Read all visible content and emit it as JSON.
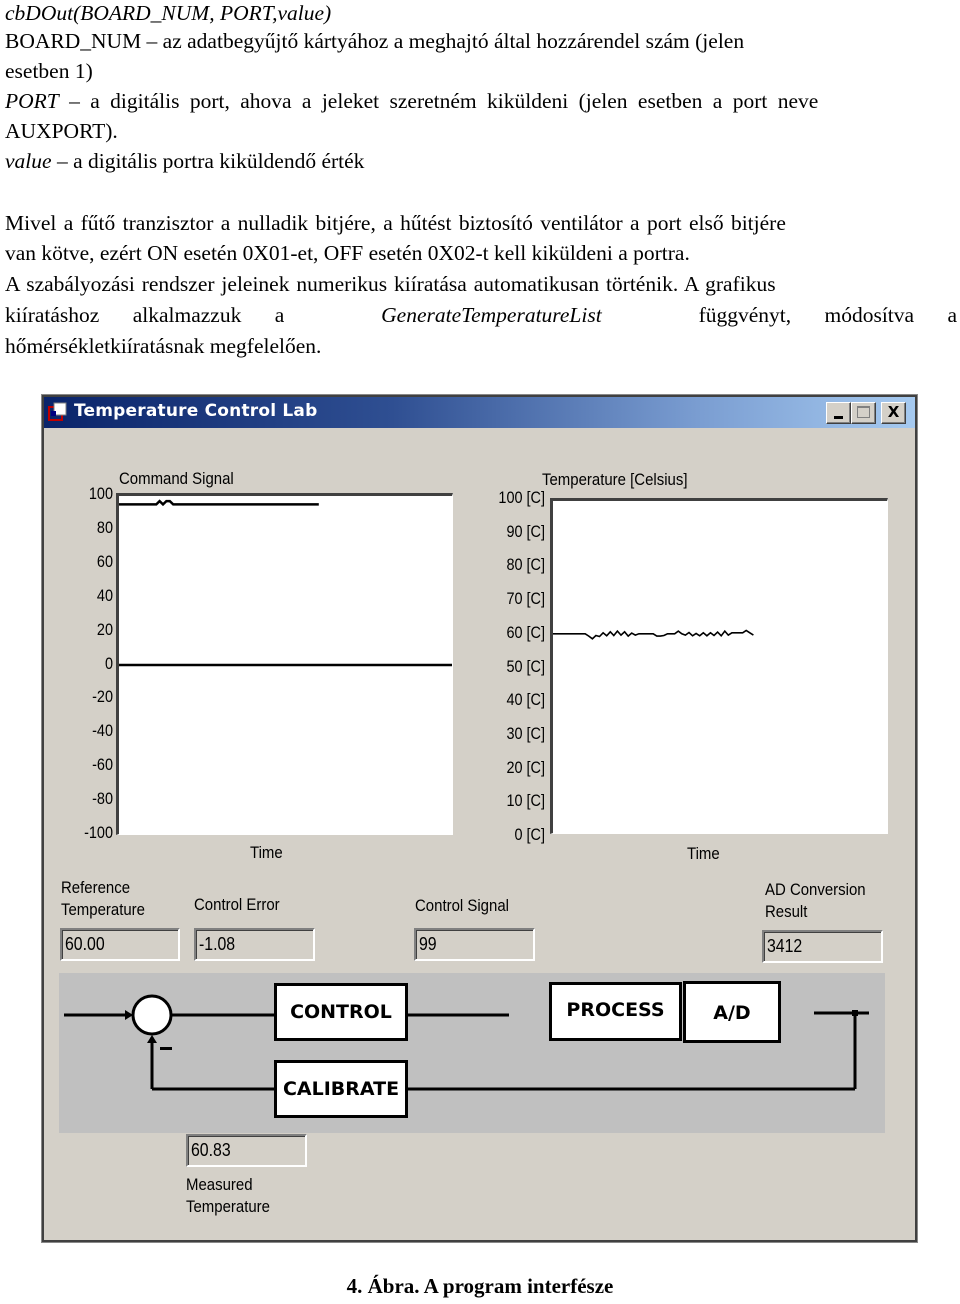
{
  "document": {
    "lines": [
      {
        "italic_prefix": "cbDOut(BOARD_NUM, PORT,value)",
        "text": ""
      },
      {
        "italic_prefix": "",
        "text": "BOARD_NUM – az adatbegyűjtő kártyához a meghajtó által hozzárendel szám (jelen"
      },
      {
        "italic_prefix": "",
        "text": "esetben 1)"
      },
      {
        "italic_prefix": "PORT",
        "text": " – a digitális port, ahova a jeleket szeretném kiküldeni (jelen esetben a port neve"
      },
      {
        "italic_prefix": "",
        "text": "AUXPORT)."
      },
      {
        "italic_prefix": "value",
        "text": " – a digitális portra kiküldendő érték"
      }
    ],
    "paragraph": [
      "Mivel a fűtő tranzisztor a nulladik bitjére, a hűtést biztosító ventilátor a port első bitjére",
      "van kötve, ezért ON esetén 0X01-et, OFF esetén 0X02-t kell kiküldeni a portra.",
      "A szabályozási rendszer jeleinek numerikus kiíratása automatikusan történik. A grafikus",
      "kiíratáshoz alkalmazzuk a",
      "GenerateTemperatureList",
      "függvényt, módosítva a",
      "hőmérsékletkiíratásnak megfelelően."
    ],
    "caption": "4. Ábra. A program interfésze"
  },
  "window": {
    "title": "Temperature Control Lab",
    "icon": "app-window-icon",
    "buttons": {
      "minimize": "minimize",
      "maximize": "maximize",
      "close": "X"
    }
  },
  "charts": {
    "command": {
      "title": "Command Signal",
      "xlabel": "Time",
      "yticks": [
        "100",
        "80",
        "60",
        "40",
        "20",
        "0",
        "-20",
        "-40",
        "-60",
        "-80",
        "-100"
      ]
    },
    "temperature": {
      "title": "Temperature [Celsius]",
      "xlabel": "Time",
      "yticks": [
        "100 [C]",
        "90 [C]",
        "80 [C]",
        "70 [C]",
        "60 [C]",
        "50 [C]",
        "40 [C]",
        "30 [C]",
        "20 [C]",
        "10 [C]",
        "0 [C]"
      ]
    }
  },
  "chart_data": [
    {
      "type": "line",
      "title": "Command Signal",
      "xlabel": "Time",
      "ylabel": "",
      "ylim": [
        -100,
        100
      ],
      "yticks": [
        100,
        80,
        60,
        40,
        20,
        0,
        -20,
        -40,
        -60,
        -80,
        -100
      ],
      "series": [
        {
          "name": "command",
          "x_fraction_end": 0.6,
          "values": [
            95,
            95,
            95,
            95,
            95,
            95,
            95,
            95,
            95,
            95,
            95,
            95,
            97,
            95,
            97,
            97,
            95,
            95,
            95,
            95,
            95,
            95,
            95,
            95,
            95,
            95,
            95,
            95,
            95,
            95,
            95,
            95,
            95,
            95,
            95,
            95,
            95,
            95,
            95,
            95,
            95,
            95,
            95,
            95,
            95,
            95,
            95,
            95,
            95,
            95,
            95,
            95,
            95,
            95,
            95,
            95,
            95,
            95,
            95,
            95
          ]
        },
        {
          "name": "zero-line",
          "x_fraction_end": 1.0,
          "values": [
            0,
            0
          ]
        }
      ]
    },
    {
      "type": "line",
      "title": "Temperature [Celsius]",
      "xlabel": "Time",
      "ylabel": "",
      "ylim": [
        0,
        100
      ],
      "yticks": [
        100,
        90,
        80,
        70,
        60,
        50,
        40,
        30,
        20,
        10,
        0
      ],
      "series": [
        {
          "name": "temperature",
          "x_fraction_end": 0.6,
          "values": [
            60,
            60,
            60,
            60,
            60,
            60,
            60,
            60,
            60,
            60,
            59.3,
            58.5,
            59.5,
            59.2,
            60.3,
            59.4,
            60.6,
            59.5,
            60.8,
            59.6,
            60.6,
            59.3,
            60.2,
            59.6,
            60,
            60,
            60,
            60,
            60,
            59.3,
            59.3,
            59.5,
            60,
            60,
            60,
            60.8,
            60,
            59.6,
            60.4,
            59.4,
            60.1,
            59.4,
            60.3,
            59.4,
            60.3,
            59.5,
            60.5,
            59.4,
            60.8,
            59.6,
            60.3,
            60.3,
            60.3,
            60.3,
            61,
            60.3,
            59.6
          ]
        }
      ]
    }
  ],
  "fields": {
    "reference_temperature": {
      "label_line1": "Reference",
      "label_line2": "Temperature",
      "value": "60.00"
    },
    "control_error": {
      "label": "Control Error",
      "value": "-1.08"
    },
    "control_signal": {
      "label": "Control Signal",
      "value": "99"
    },
    "ad_conversion": {
      "label_line1": "AD Conversion",
      "label_line2": "Result",
      "value": "3412"
    },
    "measured_temperature": {
      "label_line1": "Measured",
      "label_line2": "Temperature",
      "value": "60.83"
    }
  },
  "diagram": {
    "blocks": {
      "control": "CONTROL",
      "calibrate": "CALIBRATE",
      "process": "PROCESS",
      "ad": "A/D"
    },
    "summing_sign": "−"
  }
}
